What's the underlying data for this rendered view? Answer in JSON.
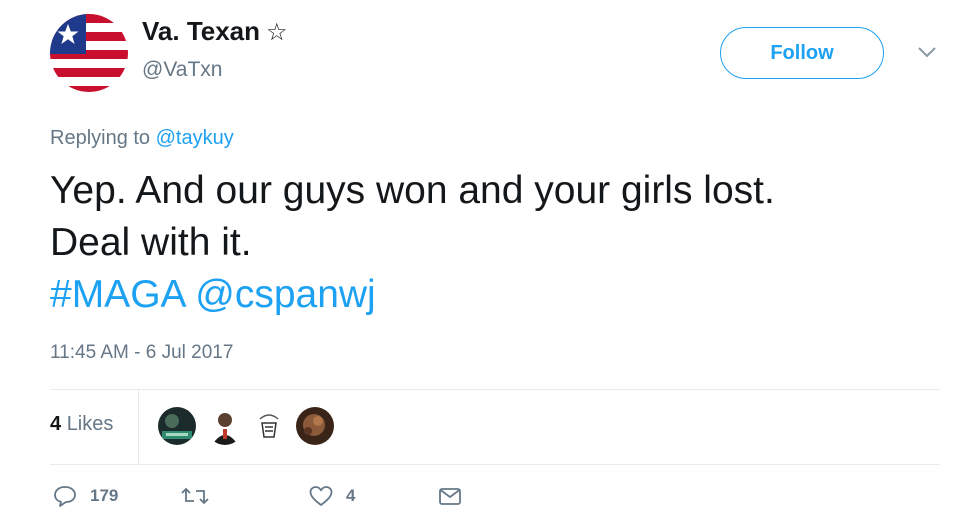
{
  "author": {
    "display_name": "Va. Texan",
    "badge": "☆",
    "handle": "@VaTxn",
    "avatar_icon": "us-flag-avatar"
  },
  "follow_label": "Follow",
  "reply_context": {
    "prefix": "Replying to ",
    "target": "@taykuy"
  },
  "tweet": {
    "line1": "Yep. And our guys won and your girls lost.",
    "line2": "Deal with it.",
    "hashtag": "#MAGA",
    "mention": "@cspanwj"
  },
  "timestamp": "11:45 AM - 6 Jul 2017",
  "stats": {
    "likes_count": "4",
    "likes_label": "Likes"
  },
  "actions": {
    "reply_count": "179",
    "retweet_count": "",
    "like_count": "4"
  },
  "colors": {
    "accent": "#1da1f2",
    "muted": "#657786",
    "text": "#14171a",
    "divider": "#e6ecf0"
  }
}
